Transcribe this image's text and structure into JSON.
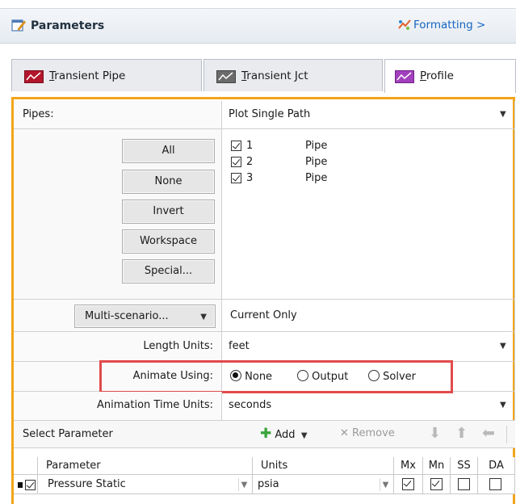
{
  "header": {
    "title": "Parameters",
    "formatting_label": "Formatting >"
  },
  "tabs": [
    {
      "label_u": "T",
      "label_rest": "ransient Pipe",
      "icon": "chart-red-icon",
      "color": "#b3162b"
    },
    {
      "label_u": "T",
      "label_rest": "ransient Jct",
      "icon": "chart-gray-icon",
      "color": "#6b6b6b"
    },
    {
      "label_u": "P",
      "label_rest": "rofile",
      "icon": "chart-purple-icon",
      "color": "#a23fbd"
    }
  ],
  "pipes": {
    "label": "Pipes:",
    "mode": "Plot Single Path",
    "buttons": [
      "All",
      "None",
      "Invert",
      "Workspace",
      "Special..."
    ],
    "items": [
      {
        "id": "1",
        "type": "Pipe",
        "checked": true
      },
      {
        "id": "2",
        "type": "Pipe",
        "checked": true
      },
      {
        "id": "3",
        "type": "Pipe",
        "checked": true
      }
    ]
  },
  "scenario": {
    "button": "Multi-scenario...",
    "value": "Current Only"
  },
  "length_units": {
    "label": "Length Units:",
    "value": "feet"
  },
  "animate": {
    "label": "Animate Using:",
    "options": [
      "None",
      "Output",
      "Solver"
    ],
    "selected": "None"
  },
  "time_units": {
    "label": "Animation Time Units:",
    "value": "seconds"
  },
  "select_parameter": {
    "title": "Select Parameter",
    "add": "Add",
    "remove": "Remove"
  },
  "grid": {
    "headers": {
      "parameter": "Parameter",
      "units": "Units",
      "mx": "Mx",
      "mn": "Mn",
      "ss": "SS",
      "da": "DA"
    },
    "rows": [
      {
        "checked": true,
        "parameter": "Pressure Static",
        "units": "psia",
        "mx": true,
        "mn": true,
        "ss": false,
        "da": false
      }
    ]
  },
  "colors": {
    "accent_frame": "#f2a51a",
    "highlight_box": "#e14b4b",
    "link": "#1565c0",
    "add_green": "#3aa53a"
  }
}
